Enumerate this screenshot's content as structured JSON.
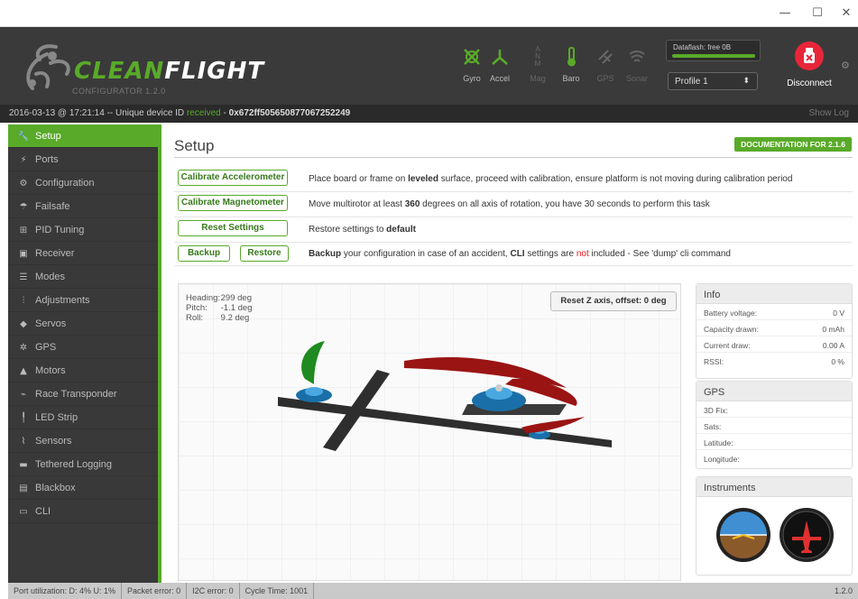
{
  "window": {
    "minimize": "—",
    "maximize": "☐",
    "close": "✕"
  },
  "header": {
    "logo_text": "CLEANFLIGHT",
    "logo_sub": "CONFIGURATOR 1.2.0",
    "sensors": [
      {
        "label": "Gyro",
        "icon": "gyro-icon",
        "active": true
      },
      {
        "label": "Accel",
        "icon": "accel-icon",
        "active": true
      },
      {
        "label": "Mag",
        "icon": "mag-icon",
        "active": false
      },
      {
        "label": "Baro",
        "icon": "baro-icon",
        "active": true
      },
      {
        "label": "GPS",
        "icon": "gps-icon",
        "active": false
      },
      {
        "label": "Sonar",
        "icon": "sonar-icon",
        "active": false
      }
    ],
    "dataflash_label": "Dataflash: free 0B",
    "profile_value": "Profile 1",
    "disconnect_label": "Disconnect",
    "accent": "#59aa29",
    "disconnect_color": "#e8263a"
  },
  "status": {
    "timestamp": "2016-03-13 @ 17:21:14 -- Unique device ID ",
    "received": "received",
    "separator": " - ",
    "device_id": "0x672ff505650877067252249",
    "show_log": "Show Log"
  },
  "sidebar": {
    "items": [
      {
        "label": "Setup",
        "icon": "wrench-icon",
        "active": true
      },
      {
        "label": "Ports",
        "icon": "plug-icon"
      },
      {
        "label": "Configuration",
        "icon": "gear-icon"
      },
      {
        "label": "Failsafe",
        "icon": "parachute-icon"
      },
      {
        "label": "PID Tuning",
        "icon": "sitemap-icon"
      },
      {
        "label": "Receiver",
        "icon": "receiver-icon"
      },
      {
        "label": "Modes",
        "icon": "toggle-icon"
      },
      {
        "label": "Adjustments",
        "icon": "sliders-icon"
      },
      {
        "label": "Servos",
        "icon": "servo-icon"
      },
      {
        "label": "GPS",
        "icon": "satellite-icon"
      },
      {
        "label": "Motors",
        "icon": "motor-icon"
      },
      {
        "label": "Race Transponder",
        "icon": "transponder-icon"
      },
      {
        "label": "LED Strip",
        "icon": "led-icon"
      },
      {
        "label": "Sensors",
        "icon": "pulse-icon"
      },
      {
        "label": "Tethered Logging",
        "icon": "log-icon"
      },
      {
        "label": "Blackbox",
        "icon": "blackbox-icon"
      },
      {
        "label": "CLI",
        "icon": "terminal-icon"
      }
    ]
  },
  "setup": {
    "title": "Setup",
    "doc_button": "DOCUMENTATION FOR 2.1.6",
    "calibrate_acc": "Calibrate Accelerometer",
    "calibrate_acc_desc_a": "Place board or frame on ",
    "calibrate_acc_desc_b": "leveled",
    "calibrate_acc_desc_c": " surface, proceed with calibration, ensure platform is not moving during calibration period",
    "calibrate_mag": "Calibrate Magnetometer",
    "calibrate_mag_desc_a": "Move multirotor at least ",
    "calibrate_mag_desc_b": "360",
    "calibrate_mag_desc_c": " degrees on all axis of rotation, you have 30 seconds to perform this task",
    "reset": "Reset Settings",
    "reset_desc_a": "Restore settings to ",
    "reset_desc_b": "default",
    "backup": "Backup",
    "restore": "Restore",
    "backup_desc_a": "Backup",
    "backup_desc_b": " your configuration in case of an accident, ",
    "backup_desc_c": "CLI",
    "backup_desc_d": " settings are ",
    "backup_desc_e": "not",
    "backup_desc_f": " included - See 'dump' cli command"
  },
  "attitude": {
    "heading_label": "Heading:",
    "heading_value": "299 deg",
    "pitch_label": "Pitch:",
    "pitch_value": "-1.1 deg",
    "roll_label": "Roll:",
    "roll_value": "9.2 deg"
  },
  "reset_z": "Reset Z axis, offset: 0 deg",
  "info": {
    "title": "Info",
    "rows": [
      {
        "label": "Battery voltage:",
        "value": "0 V"
      },
      {
        "label": "Capacity drawn:",
        "value": "0 mAh"
      },
      {
        "label": "Current draw:",
        "value": "0.00 A"
      },
      {
        "label": "RSSI:",
        "value": "0 %"
      }
    ]
  },
  "gps": {
    "title": "GPS",
    "rows": [
      {
        "label": "3D Fix:"
      },
      {
        "label": "Sats:"
      },
      {
        "label": "Latitude:"
      },
      {
        "label": "Longitude:"
      }
    ]
  },
  "instruments": {
    "title": "Instruments"
  },
  "footer": {
    "port_util": "Port utilization: D: 4% U: 1%",
    "packet_error": "Packet error: 0",
    "i2c_error": "I2C error: 0",
    "cycle_time": "Cycle Time: 1001",
    "version": "1.2.0"
  }
}
